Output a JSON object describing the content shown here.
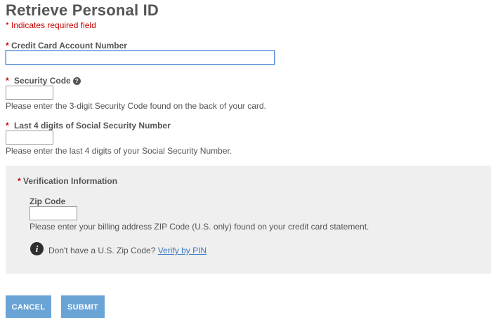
{
  "page": {
    "title": "Retrieve Personal ID",
    "required_note": "* Indicates required field"
  },
  "fields": {
    "required_marker": "*",
    "card_number": {
      "label": "Credit Card Account Number",
      "value": ""
    },
    "security_code": {
      "label": "Security Code",
      "value": "",
      "help_icon": "question-circle-icon",
      "help_text": "Please enter the 3-digit Security Code found on the back of your card."
    },
    "ssn_last4": {
      "label": "Last 4 digits of Social Security Number",
      "value": "",
      "help_text": "Please enter the last 4 digits of your Social Security Number."
    }
  },
  "verification": {
    "heading": "Verification Information",
    "zip_label": "Zip Code",
    "zip_value": "",
    "zip_help": "Please enter your billing address ZIP Code (U.S. only) found on your credit card statement.",
    "info_icon": "info-icon",
    "info_glyph": "i",
    "no_zip_text": "Don't have a U.S. Zip Code?",
    "verify_link": "Verify by PIN"
  },
  "buttons": {
    "cancel": "CANCEL",
    "submit": "SUBMIT"
  },
  "colors": {
    "required": "#cc0000",
    "button": "#6aa3d5",
    "link": "#3b78c2",
    "panel": "#efefef"
  }
}
